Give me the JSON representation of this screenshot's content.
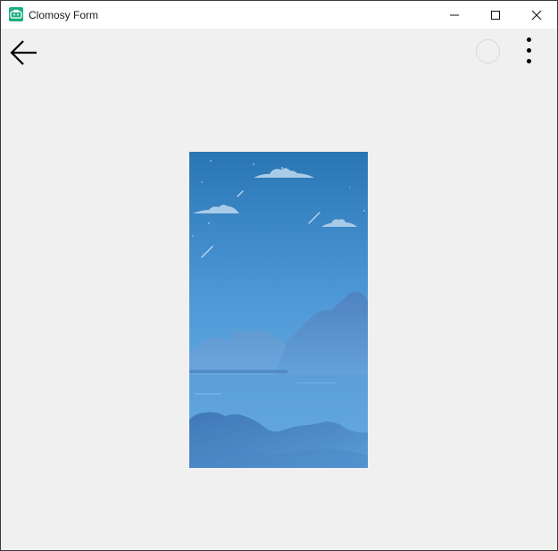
{
  "window": {
    "title": "Clomosy Form",
    "app_icon": "clomosy-app-icon",
    "controls": [
      "minimize-icon",
      "maximize-icon",
      "close-icon"
    ]
  },
  "toolbar": {
    "back_icon": "arrow-left-icon",
    "status_icon": "circle-outline-icon",
    "menu_icon": "more-vertical-icon"
  },
  "content": {
    "image": "night-sky-mountains-lake-illustration",
    "colors": {
      "sky_top": "#2a76b4",
      "sky_bottom": "#5ea6df",
      "mountains": "#4d8ac8",
      "clouds": "#a9cbe8",
      "background": "#f0f0f0"
    }
  }
}
